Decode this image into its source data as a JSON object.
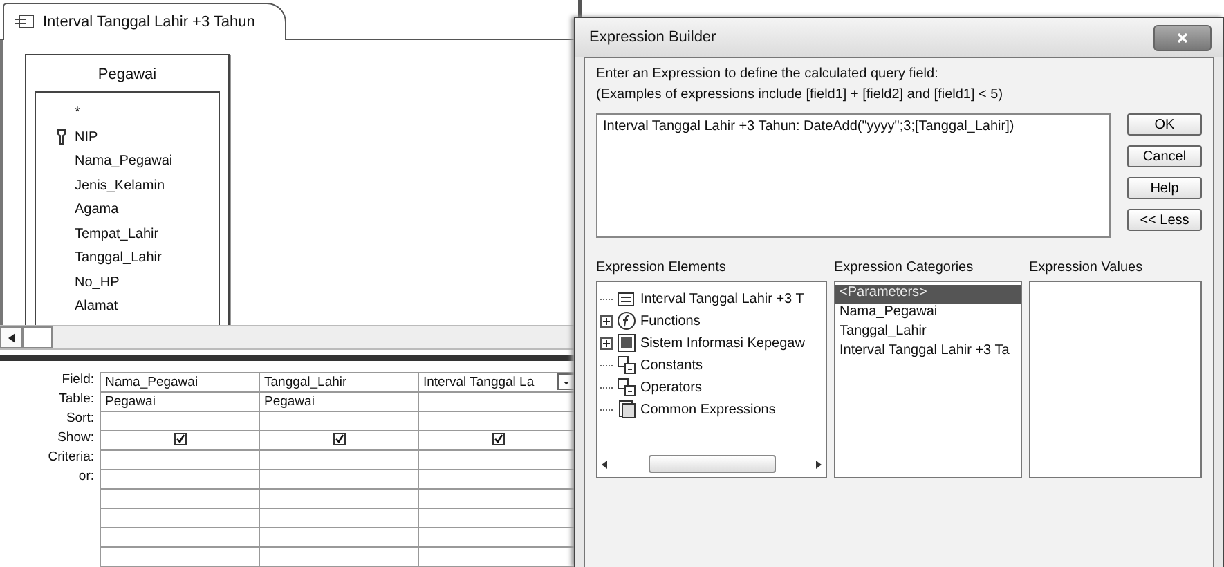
{
  "query_tab": {
    "title": "Interval Tanggal Lahir +3 Tahun"
  },
  "field_list": {
    "title": "Pegawai",
    "fields": [
      {
        "name": "*",
        "primary_key": false
      },
      {
        "name": "NIP",
        "primary_key": true
      },
      {
        "name": "Nama_Pegawai",
        "primary_key": false
      },
      {
        "name": "Jenis_Kelamin",
        "primary_key": false
      },
      {
        "name": "Agama",
        "primary_key": false
      },
      {
        "name": "Tempat_Lahir",
        "primary_key": false
      },
      {
        "name": "Tanggal_Lahir",
        "primary_key": false
      },
      {
        "name": "No_HP",
        "primary_key": false
      },
      {
        "name": "Alamat",
        "primary_key": false
      }
    ]
  },
  "design_grid": {
    "row_labels": [
      "Field:",
      "Table:",
      "Sort:",
      "Show:",
      "Criteria:",
      "or:"
    ],
    "columns": [
      {
        "field": "Nama_Pegawai",
        "table": "Pegawai",
        "show": true,
        "dropdown": false
      },
      {
        "field": "Tanggal_Lahir",
        "table": "Pegawai",
        "show": true,
        "dropdown": false
      },
      {
        "field": "Interval Tanggal La",
        "show": true,
        "dropdown": true
      }
    ]
  },
  "dialog": {
    "title": "Expression Builder",
    "instruction": "Enter an Expression to define the calculated query field:",
    "examples": "(Examples of expressions include [field1] + [field2] and [field1] < 5)",
    "expression": "Interval Tanggal Lahir +3 Tahun: DateAdd(\"yyyy\";3;[Tanggal_Lahir])",
    "buttons": [
      "OK",
      "Cancel",
      "Help",
      "<< Less"
    ],
    "elements_label": "Expression Elements",
    "elements": [
      {
        "label": "Interval Tanggal Lahir +3 T",
        "kind": "query",
        "expandable": false
      },
      {
        "label": "Functions",
        "kind": "functions",
        "expandable": true
      },
      {
        "label": "Sistem Informasi Kepegaw",
        "kind": "database",
        "expandable": true
      },
      {
        "label": "Constants",
        "kind": "constants",
        "expandable": false
      },
      {
        "label": "Operators",
        "kind": "operators",
        "expandable": false
      },
      {
        "label": "Common Expressions",
        "kind": "common",
        "expandable": false
      }
    ],
    "categories_label": "Expression Categories",
    "categories": [
      {
        "label": "<Parameters>",
        "selected": true
      },
      {
        "label": "Nama_Pegawai",
        "selected": false
      },
      {
        "label": "Tanggal_Lahir",
        "selected": false
      },
      {
        "label": "Interval Tanggal Lahir +3 Ta",
        "selected": false
      }
    ],
    "values_label": "Expression Values"
  }
}
